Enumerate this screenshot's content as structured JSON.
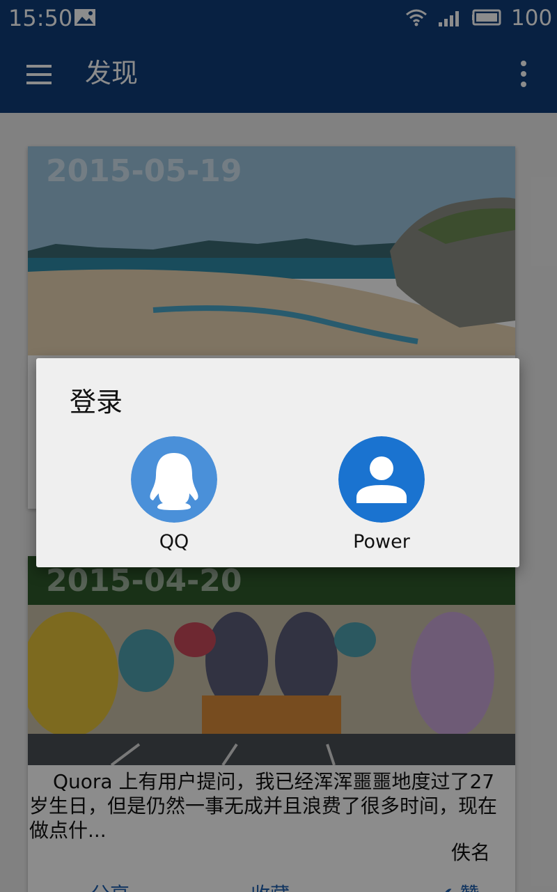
{
  "status_bar": {
    "time": "15:50",
    "battery": "100"
  },
  "app_bar": {
    "title": "发现"
  },
  "cards": [
    {
      "date": "2015-05-19",
      "text": "",
      "author": ""
    },
    {
      "date": "2015-04-20",
      "text": "Quora 上有用户提问，我已经浑浑噩噩地度过了27岁生日，但是仍然一事无成并且浪费了很多时间，现在做点什...",
      "author": "佚名",
      "actions": [
        "分享",
        "收藏",
        "赞"
      ]
    }
  ],
  "dialog": {
    "title": "登录",
    "options": [
      {
        "label": "QQ",
        "color": "#4a90d9"
      },
      {
        "label": "Power",
        "color": "#1a73d0"
      }
    ]
  },
  "colors": {
    "app_bar": "#0f3c78",
    "scrim": "rgba(0,0,0,0.45)",
    "dialog_bg": "#efefef"
  }
}
